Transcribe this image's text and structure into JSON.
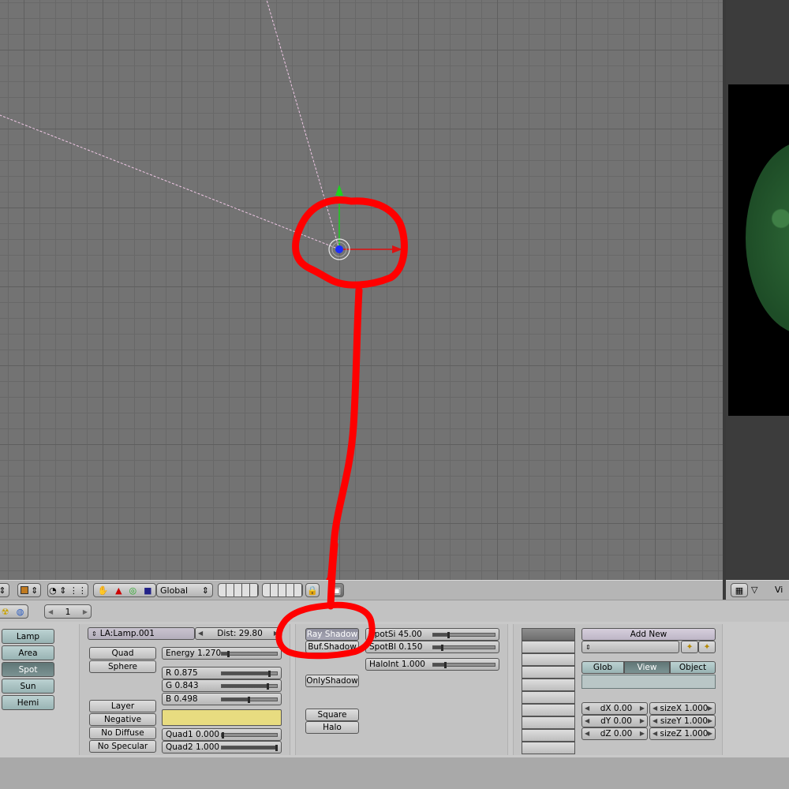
{
  "viewport_header": {
    "orientation": "Global",
    "view_label": "Vi"
  },
  "buttons_header": {
    "frame": "1"
  },
  "lamp_types": [
    "Lamp",
    "Area",
    "Spot",
    "Sun",
    "Hemi"
  ],
  "lamp_types_active": "Spot",
  "lamp_panel": {
    "name": "LA:Lamp.001",
    "dist": "Dist: 29.80",
    "quad": "Quad",
    "sphere": "Sphere",
    "energy": {
      "label": "Energy 1.270",
      "value": 1.27,
      "max": 10
    },
    "r": {
      "label": "R 0.875",
      "value": 0.875
    },
    "g": {
      "label": "G 0.843",
      "value": 0.843
    },
    "b": {
      "label": "B 0.498",
      "value": 0.498
    },
    "layer": "Layer",
    "negative": "Negative",
    "no_diffuse": "No Diffuse",
    "no_specular": "No Specular",
    "quad1": {
      "label": "Quad1 0.000",
      "value": 0.0
    },
    "quad2": {
      "label": "Quad2 1.000",
      "value": 1.0
    },
    "color_swatch": "#e8dc80"
  },
  "shadow_panel": {
    "ray_shadow": "Ray Shadow",
    "buf_shadow": "Buf.Shadow",
    "only_shadow": "OnlyShadow",
    "square": "Square",
    "halo": "Halo",
    "spotsi": {
      "label": "SpotSi 45.00",
      "value": 45.0,
      "max": 180
    },
    "spotbl": {
      "label": "SpotBl 0.150",
      "value": 0.15
    },
    "haloint": {
      "label": "HaloInt 1.000",
      "value": 1.0,
      "max": 5
    }
  },
  "texture_panel": {
    "add_new": "Add New",
    "glob": "Glob",
    "view": "View",
    "object": "Object",
    "dx": "dX 0.00",
    "dy": "dY 0.00",
    "dz": "dZ 0.00",
    "sizex": "sizeX 1.000",
    "sizey": "sizeY 1.000",
    "sizez": "sizeZ 1.000"
  },
  "colors": {
    "annotation": "#ff0000",
    "lamp_center": "#1a2cff",
    "y_axis": "#1fd11f",
    "x_axis": "#e01010"
  }
}
